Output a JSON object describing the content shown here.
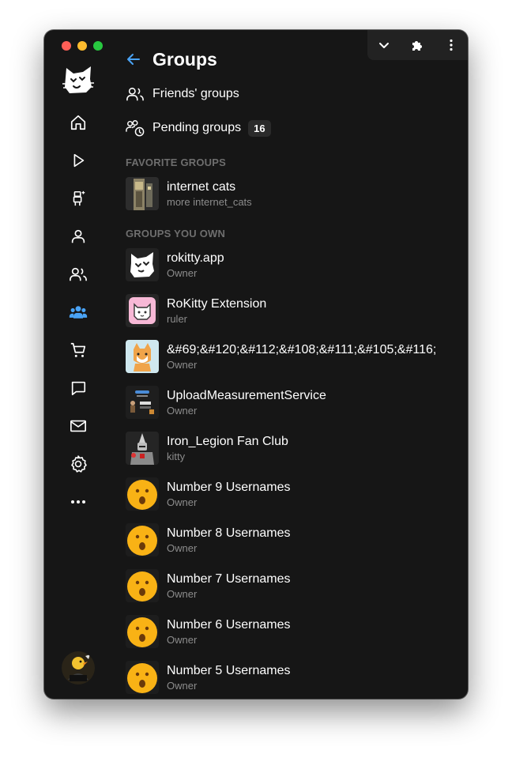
{
  "page": {
    "title": "Groups",
    "friends_groups": "Friends' groups",
    "pending_groups": "Pending groups",
    "pending_count": "16",
    "favorite_header": "FAVORITE GROUPS",
    "own_header": "GROUPS YOU OWN"
  },
  "favorites": [
    {
      "name": "internet cats",
      "sub": "more internet_cats"
    }
  ],
  "owned": [
    {
      "name": "rokitty.app",
      "sub": "Owner"
    },
    {
      "name": "RoKitty Extension",
      "sub": "ruler"
    },
    {
      "name": "&#69;&#120;&#112;&#108;&#111;&#105;&#116;",
      "sub": "Owner"
    },
    {
      "name": "UploadMeasurementService",
      "sub": "Owner"
    },
    {
      "name": "Iron_Legion Fan Club",
      "sub": "kitty"
    },
    {
      "name": "Number 9 Usernames",
      "sub": "Owner"
    },
    {
      "name": "Number 8 Usernames",
      "sub": "Owner"
    },
    {
      "name": "Number 7 Usernames",
      "sub": "Owner"
    },
    {
      "name": "Number 6 Usernames",
      "sub": "Owner"
    },
    {
      "name": "Number 5 Usernames",
      "sub": "Owner"
    }
  ],
  "sidebar": {
    "items": [
      "home-icon",
      "play-icon",
      "avatar-editor-icon",
      "profile-icon",
      "friends-icon",
      "groups-icon",
      "cart-icon",
      "chat-icon",
      "mail-icon",
      "settings-icon",
      "more-icon"
    ],
    "active": "groups-icon"
  },
  "colors": {
    "accent": "#4aa3f5",
    "background": "#161616",
    "muted": "#8c8c8c"
  }
}
